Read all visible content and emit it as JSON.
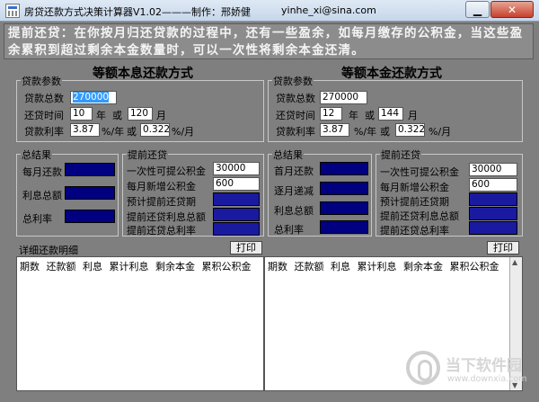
{
  "window": {
    "title": "房贷还款方式决策计算器V1.02———制作：邢娇健",
    "email": "yinhe_xi@sina.com",
    "min_glyph": "▁",
    "close_glyph": "✕"
  },
  "banner": "提前还贷：在你按月归还贷款的过程中，还有一些盈余，如每月缴存的公积金，当这些盈余累积到超过剩余本金数量时，可以一次性将剩余本金还清。",
  "left": {
    "heading": "等额本息还款方式",
    "loan_group": "贷款参数",
    "loan_total_label": "贷款总数",
    "loan_total_value": "270000",
    "term_label": "还贷时间",
    "term_years": "10",
    "year_unit": "年",
    "or_text": "或",
    "term_months": "120",
    "month_unit": "月",
    "rate_label": "贷款利率",
    "rate_year": "3.87",
    "rate_year_unit": "%/年",
    "rate_month": "0.3225",
    "rate_month_unit": "%/月",
    "result_group": "总结果",
    "monthly_pay_label": "每月还款",
    "interest_total_label": "利息总额",
    "total_rate_label": "总利率",
    "prepay_group": "提前还贷",
    "one_time_fund_label": "一次性可提公积金",
    "one_time_fund_value": "30000",
    "monthly_fund_label": "每月新增公积金",
    "monthly_fund_value": "600",
    "expected_period_label": "预计提前还贷期",
    "prepay_interest_total_label": "提前还贷利息总额",
    "prepay_total_rate_label": "提前还贷总利率",
    "detail_label": "详细还款明细",
    "print_label": "打印",
    "detail_header": "期数 还款额 利息 累计利息 剩余本金 累积公积金"
  },
  "right": {
    "heading": "等额本金还款方式",
    "loan_group": "贷款参数",
    "loan_total_label": "贷款总数",
    "loan_total_value": "270000",
    "term_label": "还贷时间",
    "term_years": "12",
    "year_unit": "年",
    "or_text": "或",
    "term_months": "144",
    "month_unit": "月",
    "rate_label": "贷款利率",
    "rate_year": "3.87",
    "rate_year_unit": "%/年",
    "rate_month": "0.3225",
    "rate_month_unit": "%/月",
    "result_group": "总结果",
    "first_month_label": "首月还款",
    "monthly_decrease_label": "逐月递减",
    "interest_total_label": "利息总额",
    "total_rate_label": "总利率",
    "prepay_group": "提前还贷",
    "one_time_fund_label": "一次性可提公积金",
    "one_time_fund_value": "30000",
    "monthly_fund_label": "每月新增公积金",
    "monthly_fund_value": "600",
    "expected_period_label": "预计提前还贷期",
    "prepay_interest_total_label": "提前还贷利息总额",
    "prepay_total_rate_label": "提前还贷总利率",
    "print_label": "打印",
    "detail_header": "期数 还款额 利息 累计利息 剩余本金 累积公积金"
  },
  "watermark": {
    "text": "当下软件园",
    "url": "www.downxia.com"
  },
  "colors": {
    "background": "#7f7f7f",
    "output_field": "#000080",
    "banner_text": "#f4f4f4"
  }
}
